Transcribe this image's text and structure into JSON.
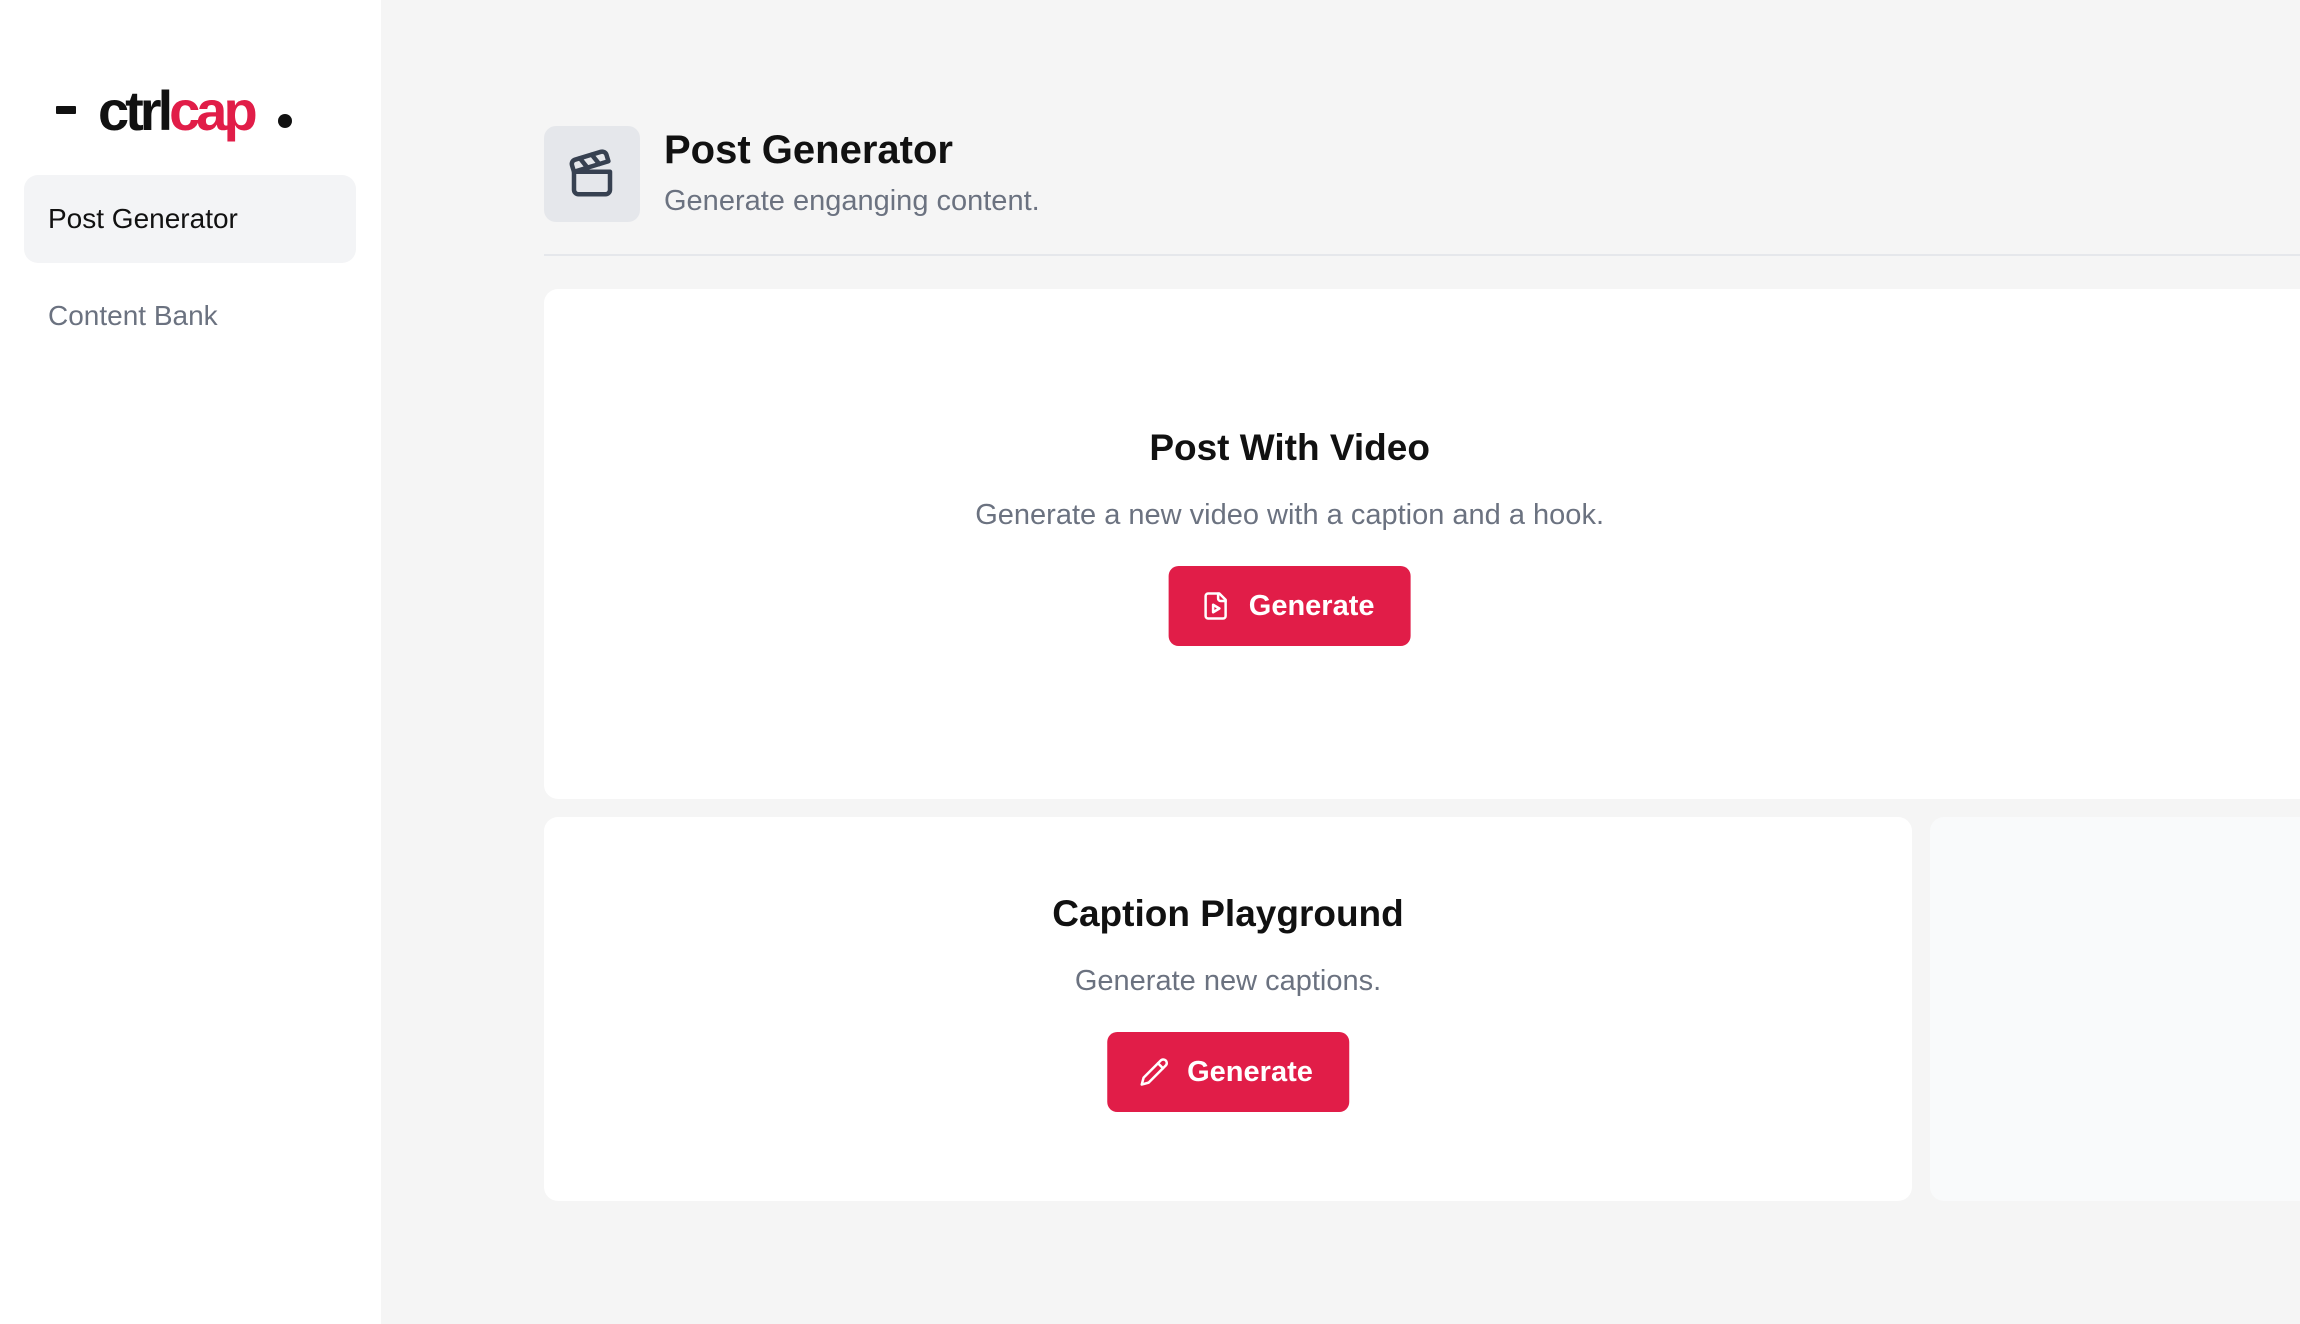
{
  "sidebar": {
    "logo": {
      "part1": "ctrl",
      "part2": "cap"
    },
    "items": [
      {
        "label": "Post Generator",
        "active": true
      },
      {
        "label": "Content Bank",
        "active": false
      }
    ]
  },
  "header": {
    "icon": "clapperboard-icon",
    "title": "Post Generator",
    "subtitle": "Generate enganging content."
  },
  "cards": {
    "video": {
      "title": "Post With Video",
      "description": "Generate a new video with a caption and a hook.",
      "button_label": "Generate",
      "button_icon": "file-video-icon"
    },
    "caption": {
      "title": "Caption Playground",
      "description": "Generate new captions.",
      "button_label": "Generate",
      "button_icon": "pencil-icon"
    }
  },
  "colors": {
    "accent": "#e11d48",
    "background": "#f5f5f5",
    "muted_text": "#6b7280"
  }
}
